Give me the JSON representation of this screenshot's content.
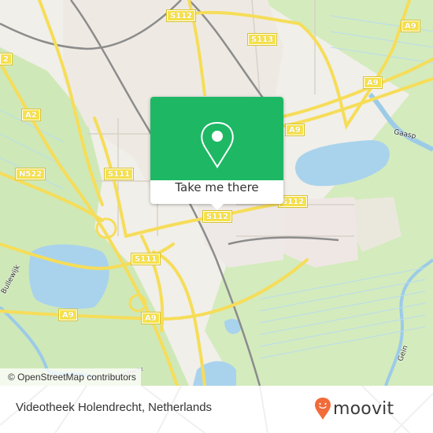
{
  "map": {
    "road_shields": [
      {
        "id": "s112-top",
        "label": "S112"
      },
      {
        "id": "s113",
        "label": "S113"
      },
      {
        "id": "a9-ne",
        "label": "A9"
      },
      {
        "id": "a9-mid",
        "label": "A9"
      },
      {
        "id": "a9-popup",
        "label": "A9"
      },
      {
        "id": "a2-edge",
        "label": "2"
      },
      {
        "id": "a2",
        "label": "A2"
      },
      {
        "id": "n522",
        "label": "N522"
      },
      {
        "id": "s111-north",
        "label": "S111"
      },
      {
        "id": "s112-right",
        "label": "S112"
      },
      {
        "id": "s112-bottom",
        "label": "S112"
      },
      {
        "id": "s111-south",
        "label": "S111"
      },
      {
        "id": "a9-west",
        "label": "A9"
      },
      {
        "id": "a9-south",
        "label": "A9"
      }
    ],
    "place_labels": [
      {
        "id": "gaasp",
        "label": "Gaasp"
      },
      {
        "id": "bullewijk",
        "label": "Bullewijk"
      },
      {
        "id": "gein",
        "label": "Gein"
      },
      {
        "id": "holendrecht",
        "label": "Holendrecht"
      }
    ],
    "attribution": "© OpenStreetMap contributors"
  },
  "popup": {
    "button_label": "Take me there",
    "icon": "map-pin-icon",
    "color": "#1eb865"
  },
  "footer": {
    "place_name": "Videotheek Holendrecht, Netherlands",
    "brand": "moovit",
    "brand_color": "#f26b3a"
  }
}
